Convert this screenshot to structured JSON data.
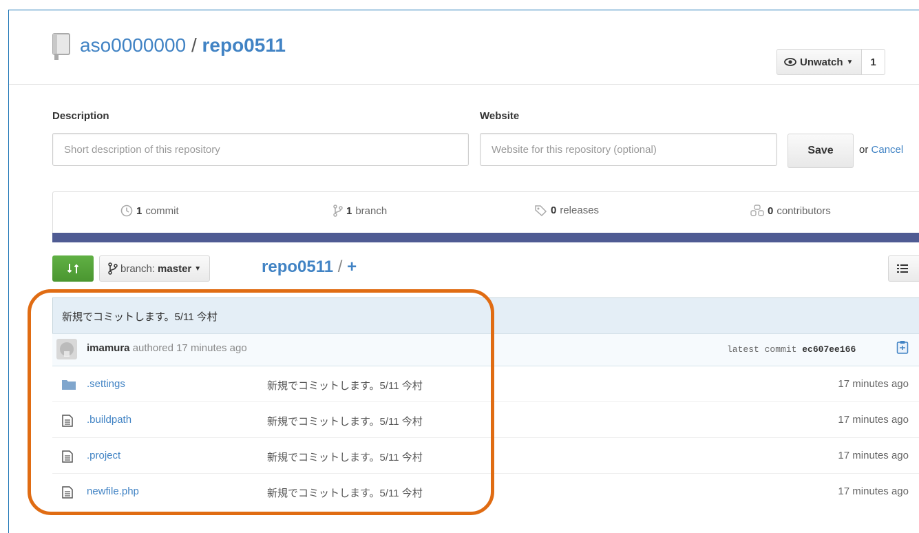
{
  "repo": {
    "owner": "aso0000000",
    "separator": "/",
    "name": "repo0511"
  },
  "watch": {
    "label": "Unwatch",
    "count": "1"
  },
  "form": {
    "description_label": "Description",
    "description_placeholder": "Short description of this repository",
    "website_label": "Website",
    "website_placeholder": "Website for this repository (optional)",
    "save_label": "Save",
    "or_text": "or",
    "cancel_label": "Cancel"
  },
  "stats": {
    "commits": {
      "count": "1",
      "label": "commit"
    },
    "branches": {
      "count": "1",
      "label": "branch"
    },
    "releases": {
      "count": "0",
      "label": "releases"
    },
    "contributors": {
      "count": "0",
      "label": "contributors"
    }
  },
  "nav": {
    "branch_prefix": "branch:",
    "branch_name": "master",
    "breadcrumb_repo": "repo0511",
    "breadcrumb_slash": "/",
    "breadcrumb_plus": "+"
  },
  "commit": {
    "message": "新規でコミットします。5/11 今村",
    "author": "imamura",
    "authored_text": "authored 17 minutes ago",
    "latest_label": "latest commit",
    "sha": "ec607ee166"
  },
  "files": [
    {
      "name": ".settings",
      "type": "folder",
      "message": "新規でコミットします。5/11 今村",
      "age": "17 minutes ago"
    },
    {
      "name": ".buildpath",
      "type": "file",
      "message": "新規でコミットします。5/11 今村",
      "age": "17 minutes ago"
    },
    {
      "name": ".project",
      "type": "file",
      "message": "新規でコミットします。5/11 今村",
      "age": "17 minutes ago"
    },
    {
      "name": "newfile.php",
      "type": "file",
      "message": "新規でコミットします。5/11 今村",
      "age": "17 minutes ago"
    }
  ],
  "colors": {
    "accent": "#4183c4",
    "highlight": "#e06c13",
    "stats_bar": "#4f5b93",
    "compare": "#60b044"
  }
}
